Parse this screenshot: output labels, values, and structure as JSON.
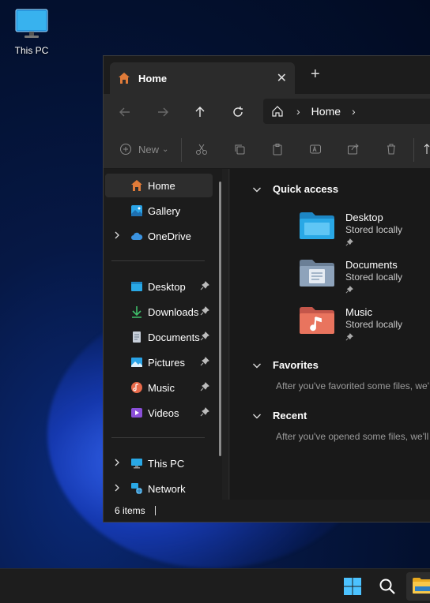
{
  "desktop": {
    "this_pc_label": "This PC"
  },
  "window": {
    "tab_title": "Home",
    "address": {
      "crumb": "Home"
    },
    "toolbar": {
      "new_label": "New"
    },
    "sidebar": {
      "top": [
        {
          "label": "Home",
          "icon": "home-icon"
        },
        {
          "label": "Gallery",
          "icon": "gallery-icon"
        },
        {
          "label": "OneDrive",
          "icon": "cloud-icon"
        }
      ],
      "pinned": [
        {
          "label": "Desktop",
          "icon": "desktop-folder-icon"
        },
        {
          "label": "Downloads",
          "icon": "download-icon"
        },
        {
          "label": "Documents",
          "icon": "document-icon"
        },
        {
          "label": "Pictures",
          "icon": "pictures-icon"
        },
        {
          "label": "Music",
          "icon": "music-icon"
        },
        {
          "label": "Videos",
          "icon": "videos-icon"
        }
      ],
      "bottom": [
        {
          "label": "This PC",
          "icon": "monitor-icon"
        },
        {
          "label": "Network",
          "icon": "network-icon"
        }
      ]
    },
    "content": {
      "quick_access": {
        "title": "Quick access",
        "items": [
          {
            "name": "Desktop",
            "sub": "Stored locally"
          },
          {
            "name": "Documents",
            "sub": "Stored locally"
          },
          {
            "name": "Music",
            "sub": "Stored locally"
          }
        ]
      },
      "favorites": {
        "title": "Favorites",
        "empty": "After you've favorited some files, we'"
      },
      "recent": {
        "title": "Recent",
        "empty": "After you've opened some files, we'll"
      }
    },
    "status": {
      "items": "6 items"
    }
  },
  "colors": {
    "accent": "#60cdff",
    "folder_blue": "#29a8e6",
    "home_orange": "#e07b39"
  }
}
